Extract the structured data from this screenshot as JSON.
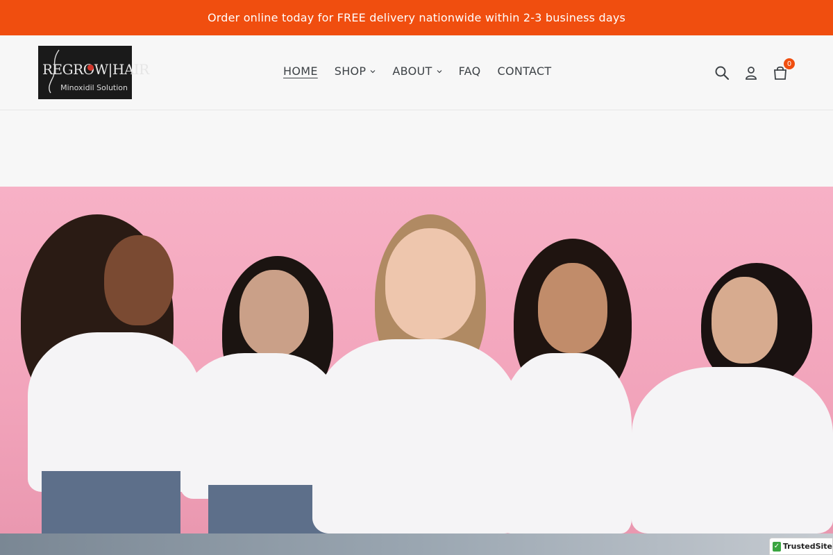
{
  "announcement": {
    "text": "Order online today for FREE delivery nationwide within 2-3 business days"
  },
  "brand": {
    "logo_text": "REGROW|HAIR",
    "logo_subtext": "Minoxidil Solution"
  },
  "nav": {
    "items": [
      {
        "label": "HOME",
        "active": true,
        "has_dropdown": false
      },
      {
        "label": "SHOP",
        "active": false,
        "has_dropdown": true
      },
      {
        "label": "ABOUT",
        "active": false,
        "has_dropdown": true
      },
      {
        "label": "FAQ",
        "active": false,
        "has_dropdown": false
      },
      {
        "label": "CONTACT",
        "active": false,
        "has_dropdown": false
      }
    ]
  },
  "header_icons": {
    "search": "search-icon",
    "account": "user-icon",
    "cart": "cart-icon",
    "cart_count": "0"
  },
  "trusted_badge": {
    "label": "TrustedSite"
  },
  "colors": {
    "accent": "#f04e0f",
    "text": "#3d4246",
    "hero_bg": "#f2a4bb"
  }
}
